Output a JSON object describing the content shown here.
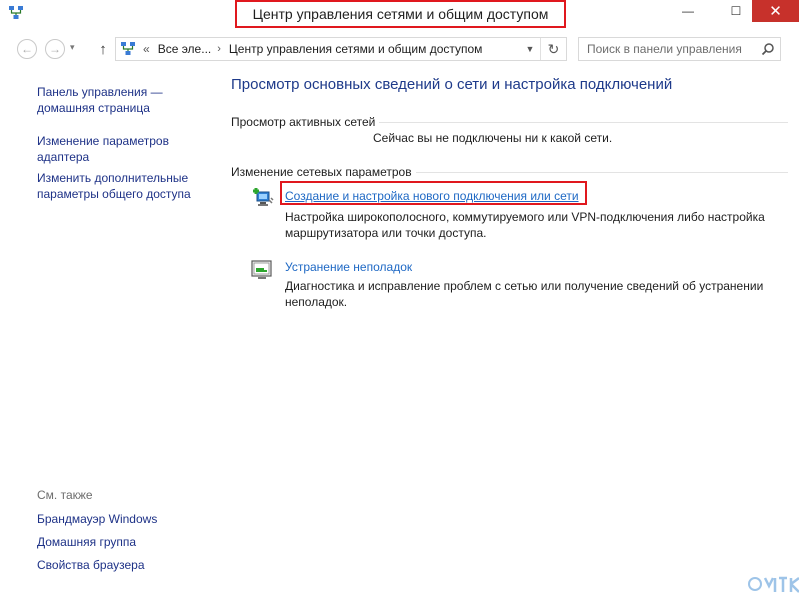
{
  "window": {
    "title": "Центр управления сетями и общим доступом",
    "controls": {
      "minimize": "—",
      "maximize": "☐",
      "close": "✕"
    }
  },
  "address": {
    "overflow": "«",
    "breadcrumbs": [
      "Все эле...",
      "Центр управления сетями и общим доступом"
    ],
    "separator": "›",
    "search_placeholder": "Поиск в панели управления"
  },
  "sidebar": {
    "home_link": "Панель управления — домашняя страница",
    "links": [
      "Изменение параметров адаптера",
      "Изменить дополнительные параметры общего доступа"
    ],
    "see_also_heading": "См. также",
    "see_also": [
      "Брандмауэр Windows",
      "Домашняя группа",
      "Свойства браузера"
    ]
  },
  "main": {
    "title": "Просмотр основных сведений о сети и настройка подключений",
    "active_networks_label": "Просмотр активных сетей",
    "active_networks_status": "Сейчас вы не подключены ни к какой сети.",
    "change_settings_label": "Изменение сетевых параметров",
    "tasks": [
      {
        "icon": "new-connection-icon",
        "link": "Создание и настройка нового подключения или сети",
        "description": "Настройка широкополосного, коммутируемого или VPN-подключения либо настройка маршрутизатора или точки доступа."
      },
      {
        "icon": "troubleshoot-icon",
        "link": "Устранение неполадок",
        "description": "Диагностика и исправление проблем с сетью или получение сведений об устранении неполадок."
      }
    ]
  },
  "colors": {
    "highlight": "#e0181e",
    "link": "#1e68c4",
    "sidebar_link": "#1e3287",
    "title": "#1e3a8a",
    "close_button": "#c7312b"
  }
}
